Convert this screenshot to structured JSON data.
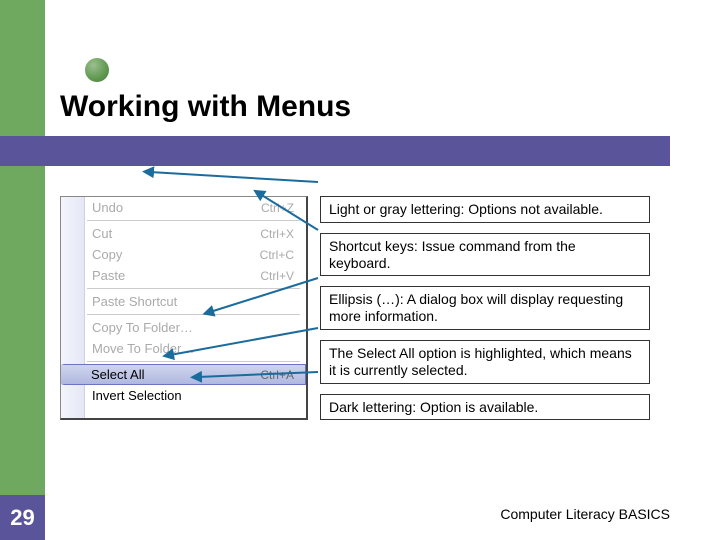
{
  "title": "Working with Menus",
  "bullet_color": "#6fa95f",
  "menu": {
    "rows": [
      {
        "label": "Undo",
        "shortcut": "Ctrl+Z",
        "disabled": true,
        "sep_after": true
      },
      {
        "label": "Cut",
        "shortcut": "Ctrl+X",
        "disabled": true
      },
      {
        "label": "Copy",
        "shortcut": "Ctrl+C",
        "disabled": true
      },
      {
        "label": "Paste",
        "shortcut": "Ctrl+V",
        "disabled": true,
        "sep_after": true
      },
      {
        "label": "Paste Shortcut",
        "shortcut": "",
        "disabled": true,
        "sep_after": true
      },
      {
        "label": "Copy To Folder…",
        "shortcut": "",
        "disabled": true
      },
      {
        "label": "Move To Folder…",
        "shortcut": "",
        "disabled": true,
        "sep_after": true
      },
      {
        "label": "Select All",
        "shortcut": "Ctrl+A",
        "disabled": false,
        "highlight": true
      },
      {
        "label": "Invert Selection",
        "shortcut": "",
        "disabled": false
      }
    ]
  },
  "callouts": [
    "Light or gray lettering: Options not available.",
    "Shortcut keys: Issue command from the keyboard.",
    "Ellipsis (…): A dialog box will display requesting more information.",
    "The Select All option is highlighted, which means it is currently selected.",
    "Dark lettering: Option is available."
  ],
  "page_number": "29",
  "footer": "Computer Literacy BASICS"
}
